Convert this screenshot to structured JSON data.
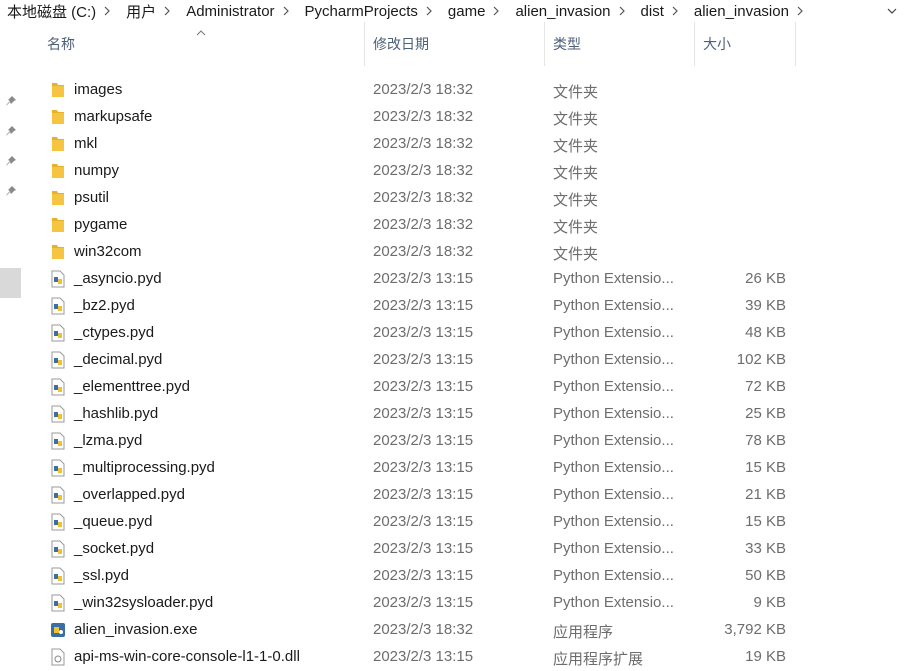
{
  "breadcrumb": [
    "本地磁盘 (C:)",
    "用户",
    "Administrator",
    "PycharmProjects",
    "game",
    "alien_invasion",
    "dist",
    "alien_invasion"
  ],
  "columns": {
    "name": "名称",
    "date": "修改日期",
    "type": "类型",
    "size": "大小"
  },
  "files": [
    {
      "name": "images",
      "date": "2023/2/3 18:32",
      "type": "文件夹",
      "size": "",
      "kind": "folder"
    },
    {
      "name": "markupsafe",
      "date": "2023/2/3 18:32",
      "type": "文件夹",
      "size": "",
      "kind": "folder"
    },
    {
      "name": "mkl",
      "date": "2023/2/3 18:32",
      "type": "文件夹",
      "size": "",
      "kind": "folder"
    },
    {
      "name": "numpy",
      "date": "2023/2/3 18:32",
      "type": "文件夹",
      "size": "",
      "kind": "folder"
    },
    {
      "name": "psutil",
      "date": "2023/2/3 18:32",
      "type": "文件夹",
      "size": "",
      "kind": "folder"
    },
    {
      "name": "pygame",
      "date": "2023/2/3 18:32",
      "type": "文件夹",
      "size": "",
      "kind": "folder"
    },
    {
      "name": "win32com",
      "date": "2023/2/3 18:32",
      "type": "文件夹",
      "size": "",
      "kind": "folder"
    },
    {
      "name": "_asyncio.pyd",
      "date": "2023/2/3 13:15",
      "type": "Python Extensio...",
      "size": "26 KB",
      "kind": "pyd"
    },
    {
      "name": "_bz2.pyd",
      "date": "2023/2/3 13:15",
      "type": "Python Extensio...",
      "size": "39 KB",
      "kind": "pyd"
    },
    {
      "name": "_ctypes.pyd",
      "date": "2023/2/3 13:15",
      "type": "Python Extensio...",
      "size": "48 KB",
      "kind": "pyd"
    },
    {
      "name": "_decimal.pyd",
      "date": "2023/2/3 13:15",
      "type": "Python Extensio...",
      "size": "102 KB",
      "kind": "pyd"
    },
    {
      "name": "_elementtree.pyd",
      "date": "2023/2/3 13:15",
      "type": "Python Extensio...",
      "size": "72 KB",
      "kind": "pyd"
    },
    {
      "name": "_hashlib.pyd",
      "date": "2023/2/3 13:15",
      "type": "Python Extensio...",
      "size": "25 KB",
      "kind": "pyd"
    },
    {
      "name": "_lzma.pyd",
      "date": "2023/2/3 13:15",
      "type": "Python Extensio...",
      "size": "78 KB",
      "kind": "pyd"
    },
    {
      "name": "_multiprocessing.pyd",
      "date": "2023/2/3 13:15",
      "type": "Python Extensio...",
      "size": "15 KB",
      "kind": "pyd"
    },
    {
      "name": "_overlapped.pyd",
      "date": "2023/2/3 13:15",
      "type": "Python Extensio...",
      "size": "21 KB",
      "kind": "pyd"
    },
    {
      "name": "_queue.pyd",
      "date": "2023/2/3 13:15",
      "type": "Python Extensio...",
      "size": "15 KB",
      "kind": "pyd"
    },
    {
      "name": "_socket.pyd",
      "date": "2023/2/3 13:15",
      "type": "Python Extensio...",
      "size": "33 KB",
      "kind": "pyd"
    },
    {
      "name": "_ssl.pyd",
      "date": "2023/2/3 13:15",
      "type": "Python Extensio...",
      "size": "50 KB",
      "kind": "pyd"
    },
    {
      "name": "_win32sysloader.pyd",
      "date": "2023/2/3 13:15",
      "type": "Python Extensio...",
      "size": "9 KB",
      "kind": "pyd"
    },
    {
      "name": "alien_invasion.exe",
      "date": "2023/2/3 18:32",
      "type": "应用程序",
      "size": "3,792 KB",
      "kind": "exe"
    },
    {
      "name": "api-ms-win-core-console-l1-1-0.dll",
      "date": "2023/2/3 13:15",
      "type": "应用程序扩展",
      "size": "19 KB",
      "kind": "dll"
    }
  ],
  "colors": {
    "folder": "#f5c542",
    "header_text": "#4c607a",
    "meta_text": "#6d6d6d",
    "nav_selected": "#d9d9d9"
  }
}
